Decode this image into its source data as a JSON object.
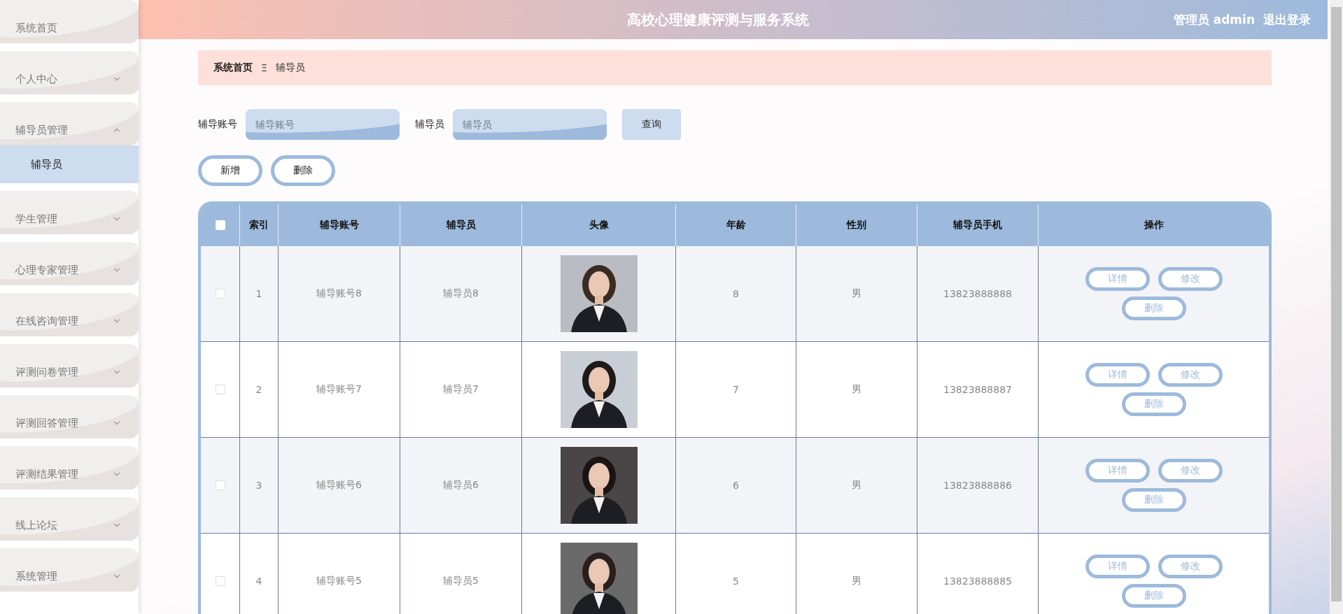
{
  "sidebar": {
    "items": [
      {
        "label": "系统首页",
        "kind": "link"
      },
      {
        "label": "个人中心",
        "kind": "menu",
        "expanded": false
      },
      {
        "label": "辅导员管理",
        "kind": "menu",
        "expanded": true,
        "children": [
          {
            "label": "辅导员",
            "selected": true
          }
        ]
      },
      {
        "label": "学生管理",
        "kind": "menu",
        "expanded": false
      },
      {
        "label": "心理专家管理",
        "kind": "menu",
        "expanded": false
      },
      {
        "label": "在线咨询管理",
        "kind": "menu",
        "expanded": false
      },
      {
        "label": "评测问卷管理",
        "kind": "menu",
        "expanded": false
      },
      {
        "label": "评测回答管理",
        "kind": "menu",
        "expanded": false
      },
      {
        "label": "评测结果管理",
        "kind": "menu",
        "expanded": false
      },
      {
        "label": "线上论坛",
        "kind": "menu",
        "expanded": false
      },
      {
        "label": "系统管理",
        "kind": "menu",
        "expanded": false
      }
    ]
  },
  "header": {
    "title": "高校心理健康评测与服务系统",
    "user": "管理员 admin",
    "logout": "退出登录"
  },
  "breadcrumb": {
    "home": "系统首页",
    "separator": "Ξ",
    "current": "辅导员"
  },
  "search": {
    "fields": [
      {
        "label": "辅导账号",
        "placeholder": "辅导账号"
      },
      {
        "label": "辅导员",
        "placeholder": "辅导员"
      }
    ],
    "button": "查询"
  },
  "actions": [
    "新增",
    "删除"
  ],
  "table": {
    "all_checked": false,
    "columns": [
      "索引",
      "辅导账号",
      "辅导员",
      "头像",
      "年龄",
      "性别",
      "辅导员手机",
      "操作"
    ],
    "rows": [
      {
        "checked": false,
        "cells": [
          "1",
          "辅导账号8",
          "辅导员8",
          {
            "kind": "picture"
          },
          "8",
          "男",
          "13823888888"
        ],
        "buttons": [
          "详情",
          "修改",
          "删除"
        ]
      },
      {
        "checked": false,
        "cells": [
          "2",
          "辅导账号7",
          "辅导员7",
          {
            "kind": "picture"
          },
          "7",
          "男",
          "13823888887"
        ],
        "buttons": [
          "详情",
          "修改",
          "删除"
        ]
      },
      {
        "checked": false,
        "cells": [
          "3",
          "辅导账号6",
          "辅导员6",
          {
            "kind": "picture"
          },
          "6",
          "男",
          "13823888886"
        ],
        "buttons": [
          "详情",
          "修改",
          "删除"
        ]
      },
      {
        "checked": false,
        "cells": [
          "4",
          "辅导账号5",
          "辅导员5",
          {
            "kind": "picture"
          },
          "5",
          "男",
          "13823888885"
        ],
        "buttons": [
          "详情",
          "修改",
          "删除"
        ]
      }
    ]
  }
}
